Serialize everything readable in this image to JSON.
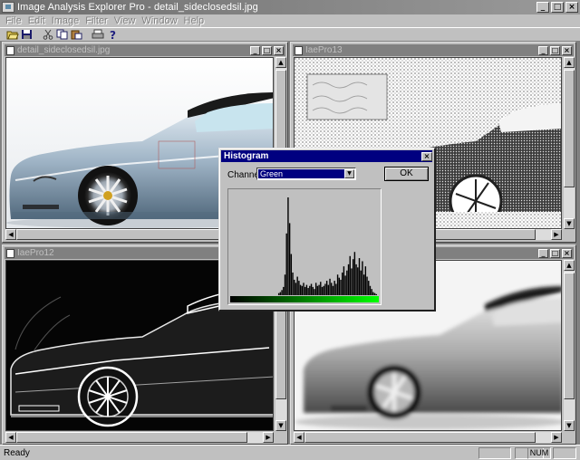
{
  "app": {
    "title": "Image Analysis Explorer Pro - detail_sideclosedsil.jpg"
  },
  "menu": [
    "File",
    "Edit",
    "Image",
    "Filter",
    "View",
    "Window",
    "Help"
  ],
  "toolbar": [
    {
      "icon": "open-folder-icon"
    },
    {
      "icon": "save-icon"
    },
    {
      "icon": "cut-icon"
    },
    {
      "icon": "copy-icon"
    },
    {
      "icon": "paste-icon"
    },
    {
      "icon": "print-icon"
    },
    {
      "icon": "help-icon"
    }
  ],
  "windows": {
    "top_left": {
      "title": "detail_sideclosedsil.jpg"
    },
    "top_right": {
      "title": "IaePro13"
    },
    "bottom_left": {
      "title": "IaePro12"
    },
    "bottom_right": {
      "title": ""
    }
  },
  "histogram": {
    "title": "Histogram",
    "channel_label": "Channel:",
    "channel_value": "Green",
    "ok_label": "OK",
    "colors": {
      "gradient_start": "#000000",
      "gradient_end": "#00ff00",
      "bars": "#000000"
    }
  },
  "chart_data": {
    "type": "bar",
    "title": "",
    "x_range": [
      0,
      255
    ],
    "values": [
      0,
      0,
      0,
      0,
      0,
      0,
      0,
      0,
      0,
      0,
      0,
      0,
      0,
      0,
      0,
      0,
      0,
      0,
      0,
      0,
      0,
      0,
      0,
      0,
      0,
      0,
      0,
      0,
      0,
      0,
      0,
      2,
      3,
      5,
      8,
      20,
      60,
      95,
      70,
      40,
      22,
      15,
      12,
      18,
      14,
      10,
      9,
      12,
      8,
      10,
      7,
      9,
      11,
      8,
      6,
      12,
      9,
      10,
      13,
      8,
      9,
      11,
      14,
      10,
      16,
      12,
      9,
      14,
      11,
      20,
      17,
      15,
      22,
      28,
      19,
      24,
      30,
      38,
      26,
      35,
      42,
      30,
      27,
      36,
      24,
      33,
      20,
      28,
      18,
      14,
      9,
      6,
      3,
      2,
      1,
      0
    ]
  },
  "status": {
    "text": "Ready",
    "num": "NUM"
  }
}
